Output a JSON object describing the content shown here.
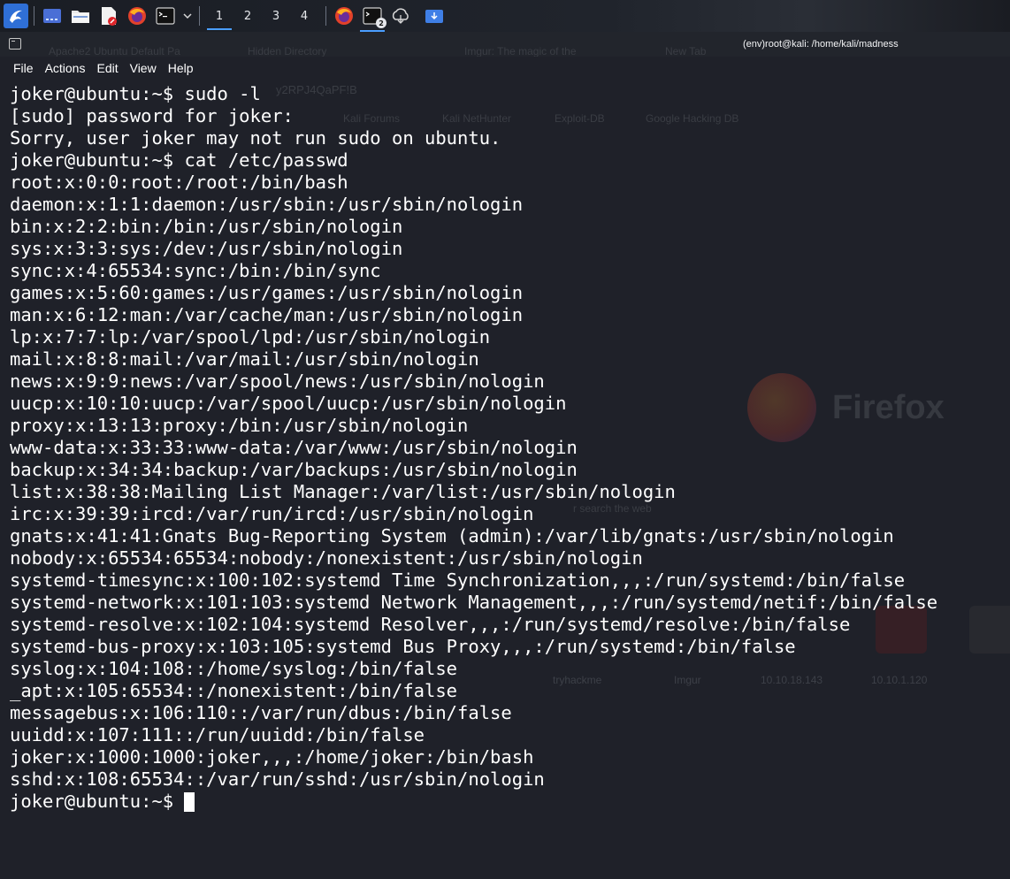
{
  "taskbar": {
    "icons": [
      "kali-dragon-icon",
      "desktop-icon",
      "file-manager-icon",
      "text-editor-icon",
      "firefox-icon",
      "terminal-icon",
      "chevron-down-icon"
    ],
    "workspaces": [
      "1",
      "2",
      "3",
      "4"
    ],
    "active_workspace": "1",
    "right_icons": [
      "firefox-icon",
      "terminal-icon",
      "cloud-icon",
      "download-icon"
    ],
    "terminal_badge": "2",
    "colors": {
      "accent": "#4a9eff"
    }
  },
  "window": {
    "title": "(env)root@kali: /home/kali/madness",
    "background_tabs": [
      "Apache2 Ubuntu Default Pa",
      "Hidden Directory",
      "Imgur: The magic of the",
      "New Tab"
    ],
    "background_bookmarks": [
      "Kali Forums",
      "Kali NetHunter",
      "Exploit-DB",
      "Google Hacking DB"
    ],
    "background_url_fragment": "y2RPJ4QaPF!B",
    "background_brand": "Firefox",
    "background_search_hint": "r search the web",
    "background_tiles": [
      "tryhackme",
      "Imgur",
      "10.10.18.143",
      "10.10.1.120"
    ]
  },
  "menu": {
    "items": [
      "File",
      "Actions",
      "Edit",
      "View",
      "Help"
    ]
  },
  "terminal": {
    "lines": [
      "joker@ubuntu:~$ sudo -l",
      "[sudo] password for joker:",
      "Sorry, user joker may not run sudo on ubuntu.",
      "joker@ubuntu:~$ cat /etc/passwd",
      "root:x:0:0:root:/root:/bin/bash",
      "daemon:x:1:1:daemon:/usr/sbin:/usr/sbin/nologin",
      "bin:x:2:2:bin:/bin:/usr/sbin/nologin",
      "sys:x:3:3:sys:/dev:/usr/sbin/nologin",
      "sync:x:4:65534:sync:/bin:/bin/sync",
      "games:x:5:60:games:/usr/games:/usr/sbin/nologin",
      "man:x:6:12:man:/var/cache/man:/usr/sbin/nologin",
      "lp:x:7:7:lp:/var/spool/lpd:/usr/sbin/nologin",
      "mail:x:8:8:mail:/var/mail:/usr/sbin/nologin",
      "news:x:9:9:news:/var/spool/news:/usr/sbin/nologin",
      "uucp:x:10:10:uucp:/var/spool/uucp:/usr/sbin/nologin",
      "proxy:x:13:13:proxy:/bin:/usr/sbin/nologin",
      "www-data:x:33:33:www-data:/var/www:/usr/sbin/nologin",
      "backup:x:34:34:backup:/var/backups:/usr/sbin/nologin",
      "list:x:38:38:Mailing List Manager:/var/list:/usr/sbin/nologin",
      "irc:x:39:39:ircd:/var/run/ircd:/usr/sbin/nologin",
      "gnats:x:41:41:Gnats Bug-Reporting System (admin):/var/lib/gnats:/usr/sbin/nologin",
      "nobody:x:65534:65534:nobody:/nonexistent:/usr/sbin/nologin",
      "systemd-timesync:x:100:102:systemd Time Synchronization,,,:/run/systemd:/bin/false",
      "systemd-network:x:101:103:systemd Network Management,,,:/run/systemd/netif:/bin/false",
      "systemd-resolve:x:102:104:systemd Resolver,,,:/run/systemd/resolve:/bin/false",
      "systemd-bus-proxy:x:103:105:systemd Bus Proxy,,,:/run/systemd:/bin/false",
      "syslog:x:104:108::/home/syslog:/bin/false",
      "_apt:x:105:65534::/nonexistent:/bin/false",
      "messagebus:x:106:110::/var/run/dbus:/bin/false",
      "uuidd:x:107:111::/run/uuidd:/bin/false",
      "joker:x:1000:1000:joker,,,:/home/joker:/bin/bash",
      "sshd:x:108:65534::/var/run/sshd:/usr/sbin/nologin"
    ],
    "prompt": "joker@ubuntu:~$",
    "colors": {
      "background": "#1f2129",
      "foreground": "#ffffff"
    }
  }
}
